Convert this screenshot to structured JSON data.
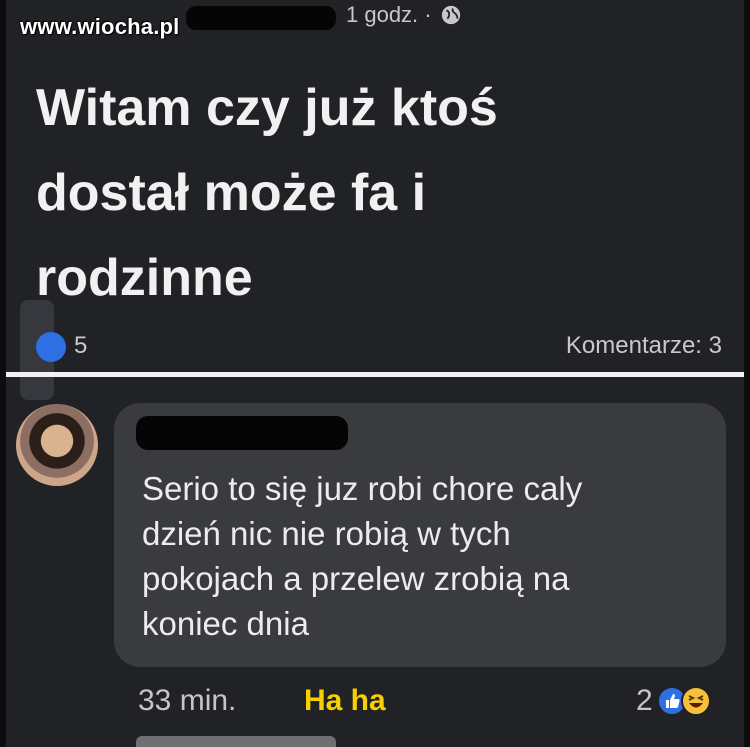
{
  "watermark": {
    "text": "www.wiocha.pl"
  },
  "post": {
    "time": "1 godz. ·",
    "privacy_icon": "globe-icon",
    "text_lines": [
      "Witam czy już ktoś",
      "dostał może fa i",
      "rodzinne"
    ],
    "reactions": {
      "count": "5",
      "icon": "like-icon"
    },
    "comments_label": "Komentarze: 3"
  },
  "comment": {
    "text_lines": [
      "Serio to się juz robi chore caly",
      "dzień nic nie robią w tych",
      "pokojach a przelew zrobią na",
      "koniec dnia"
    ],
    "time": "33 min.",
    "reaction_action": "Ha ha",
    "reaction_count": "2",
    "reaction_icons": [
      "like-icon",
      "haha-icon"
    ]
  },
  "colors": {
    "background": "#212226",
    "bubble": "#3a3b3f",
    "haha_yellow": "#f7d000",
    "like_blue": "#2f6fe4"
  }
}
